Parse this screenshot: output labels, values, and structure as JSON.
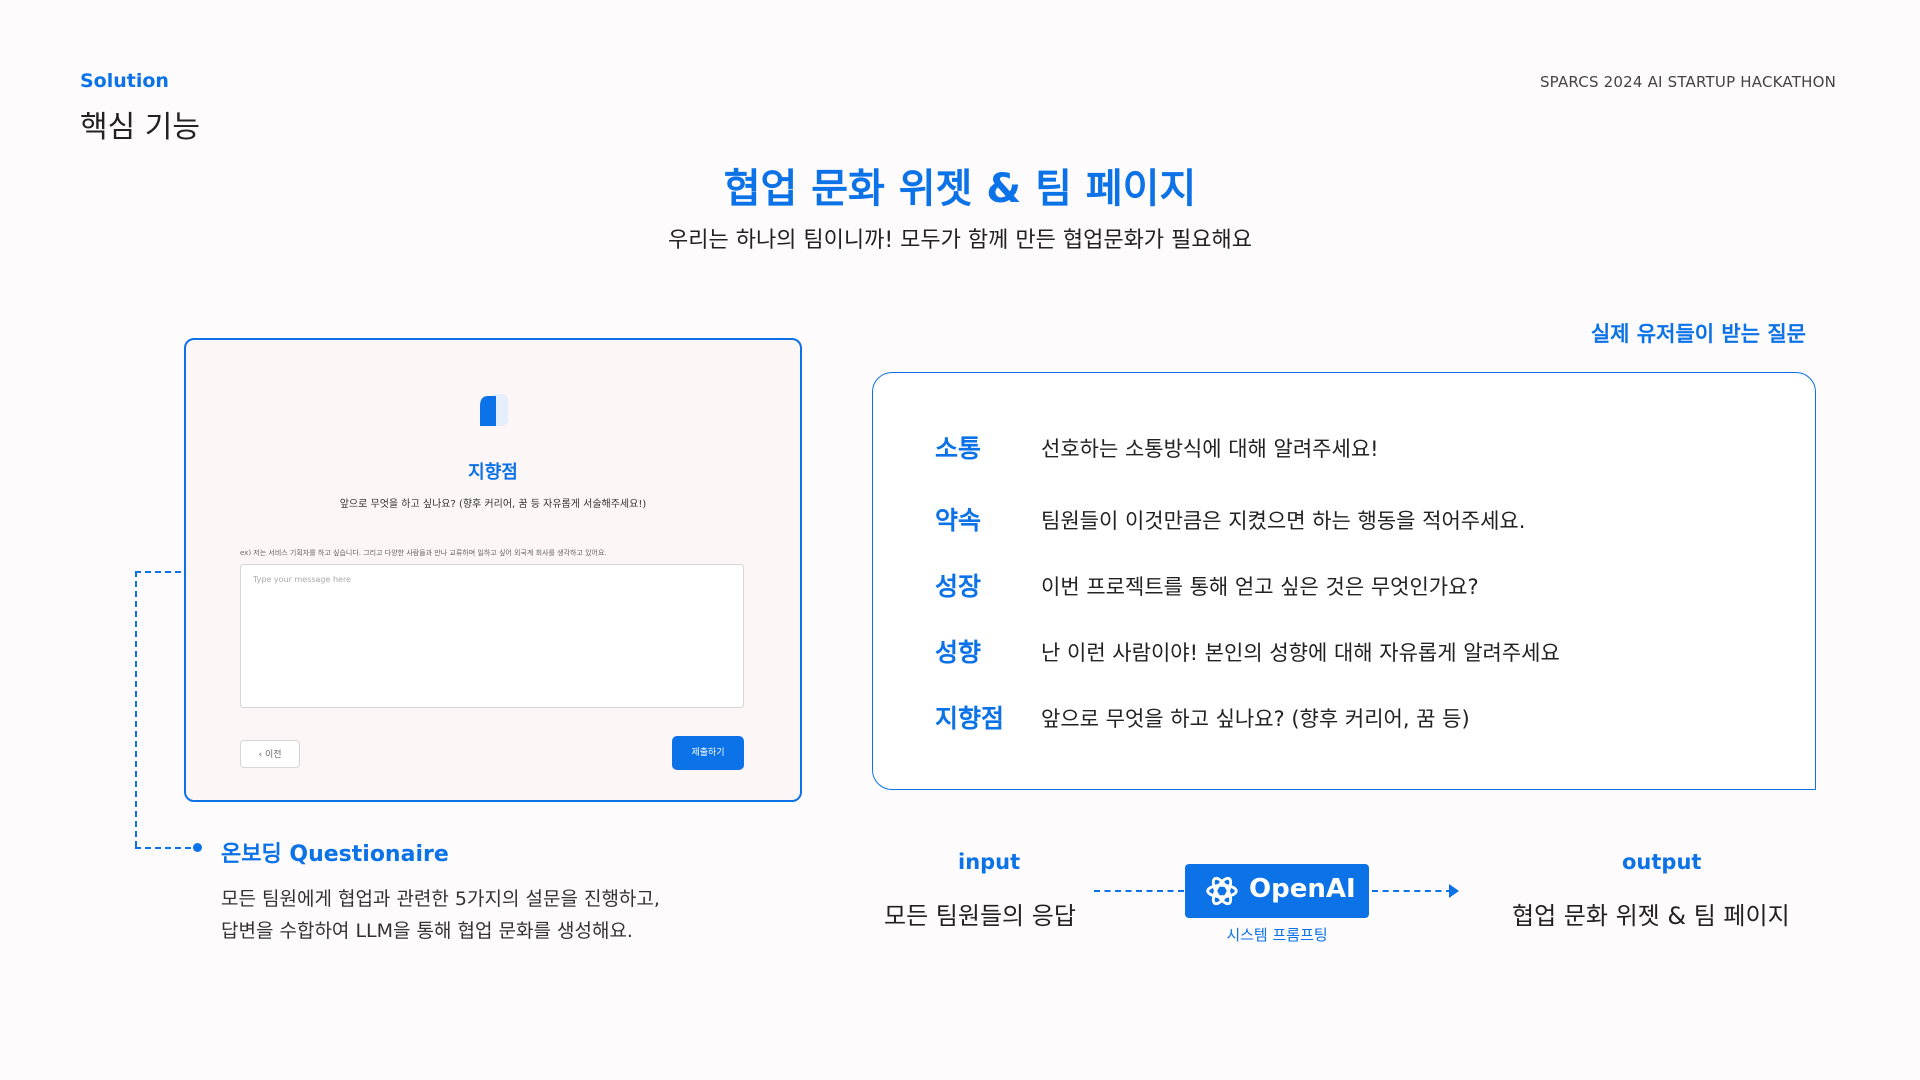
{
  "header": {
    "section": "Solution",
    "heading": "핵심 기능",
    "brand": "SPARCS 2024 AI STARTUP HACKATHON"
  },
  "hero": {
    "title": "협업 문화 위젯 & 팀 페이지",
    "subtitle": "우리는 하나의 팀이니까! 모두가 함께 만든 협업문화가 필요해요"
  },
  "questionnaire_card": {
    "title": "지향점",
    "question": "앞으로 무엇을 하고 싶나요? (향후 커리어, 꿈 등 자유롭게 서술해주세요!)",
    "hint": "ex) 저는 서비스 기획자를 하고 싶습니다. 그리고 다양한 사람들과 만나 교류하며 일하고 싶어 외국계 회사를 생각하고 있어요.",
    "placeholder": "Type your message here",
    "prev_label": "이전",
    "submit_label": "제출하기"
  },
  "onboarding": {
    "title": "온보딩 Questionaire",
    "lines": [
      "모든 팀원에게 협업과 관련한 5가지의 설문을 진행하고,",
      "답변을 수합하여 LLM을 통해 협업 문화를 생성해요."
    ]
  },
  "questions": {
    "label": "실제 유저들이 받는 질문",
    "items": [
      {
        "key": "소통",
        "text": "선호하는 소통방식에 대해 알려주세요!"
      },
      {
        "key": "약속",
        "text": "팀원들이 이것만큼은 지켰으면 하는 행동을 적어주세요."
      },
      {
        "key": "성장",
        "text": "이번 프로젝트를 통해 얻고 싶은 것은 무엇인가요?"
      },
      {
        "key": "성향",
        "text": "난 이런 사람이야! 본인의 성향에 대해 자유롭게 알려주세요"
      },
      {
        "key": "지향점",
        "text": "앞으로 무엇을 하고 싶나요? (향후 커리어, 꿈 등)"
      }
    ]
  },
  "pipeline": {
    "input_label": "input",
    "input_text": "모든 팀원들의 응답",
    "engine": "OpenAI",
    "engine_caption": "시스템 프롬프팅",
    "output_label": "output",
    "output_text": "협업 문화 위젯 & 팀 페이지"
  },
  "colors": {
    "accent": "#0b72e7",
    "background": "#fdfbfc",
    "card_background": "#fcf6f7"
  },
  "icons": [
    "book-logo-icon",
    "chevron-left-icon",
    "openai-logo-icon"
  ]
}
